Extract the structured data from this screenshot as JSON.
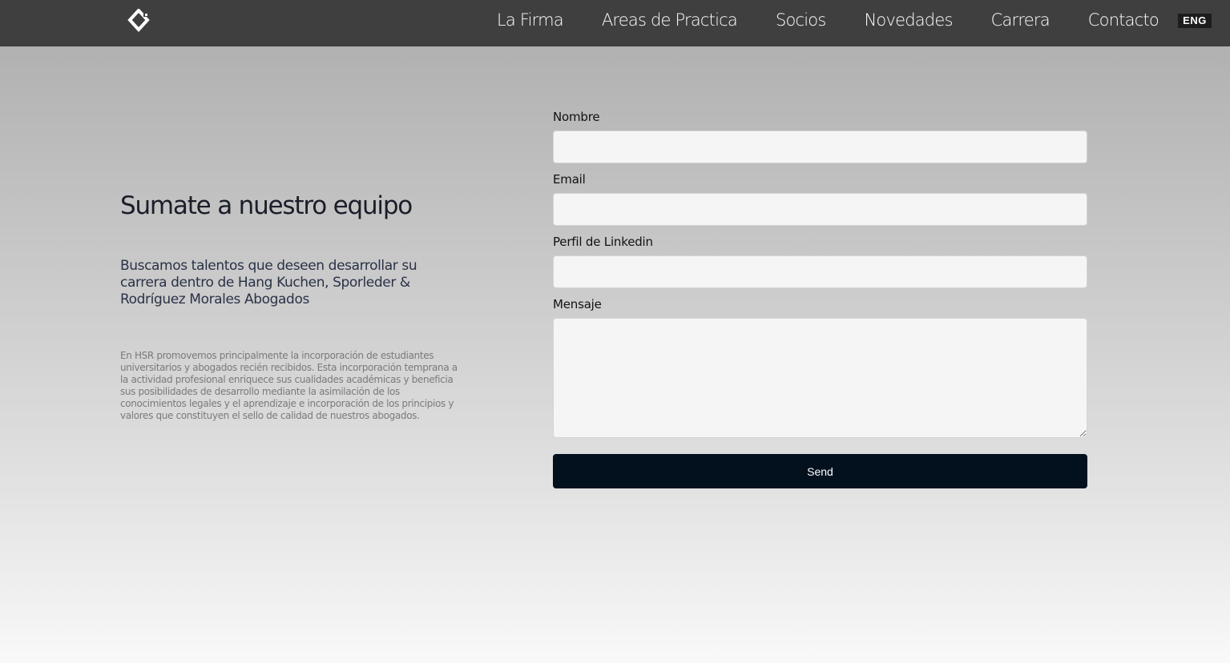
{
  "header": {
    "logo_icon": "diamond-logo-icon",
    "nav": [
      {
        "label": "La Firma"
      },
      {
        "label": "Areas de Practica"
      },
      {
        "label": "Socios"
      },
      {
        "label": "Novedades"
      },
      {
        "label": "Carrera"
      },
      {
        "label": "Contacto"
      }
    ],
    "lang": "ENG"
  },
  "intro": {
    "title": "Sumate a nuestro equipo",
    "lead": "Buscamos talentos que deseen desarrollar su carrera dentro de Hang Kuchen, Sporleder & Rodríguez Morales Abogados",
    "body": "En HSR promovemos principalmente la incorporación de estudiantes universitarios y abogados recién recibidos. Esta incorporación temprana a la actividad profesional enriquece sus cualidades académicas y beneficia sus posibilidades de desarrollo mediante la asimilación de los conocimientos legales y el aprendizaje e incorporación de los principios y valores que constituyen el sello de calidad de nuestros abogados."
  },
  "form": {
    "name_label": "Nombre",
    "name_value": "",
    "email_label": "Email",
    "email_value": "",
    "linkedin_label": "Perfil de Linkedin",
    "linkedin_value": "",
    "message_label": "Mensaje",
    "message_value": "",
    "send_label": "Send"
  },
  "colors": {
    "topbar": "#3f3f3f",
    "button": "#03111f",
    "input_bg": "#f5f5f5"
  }
}
